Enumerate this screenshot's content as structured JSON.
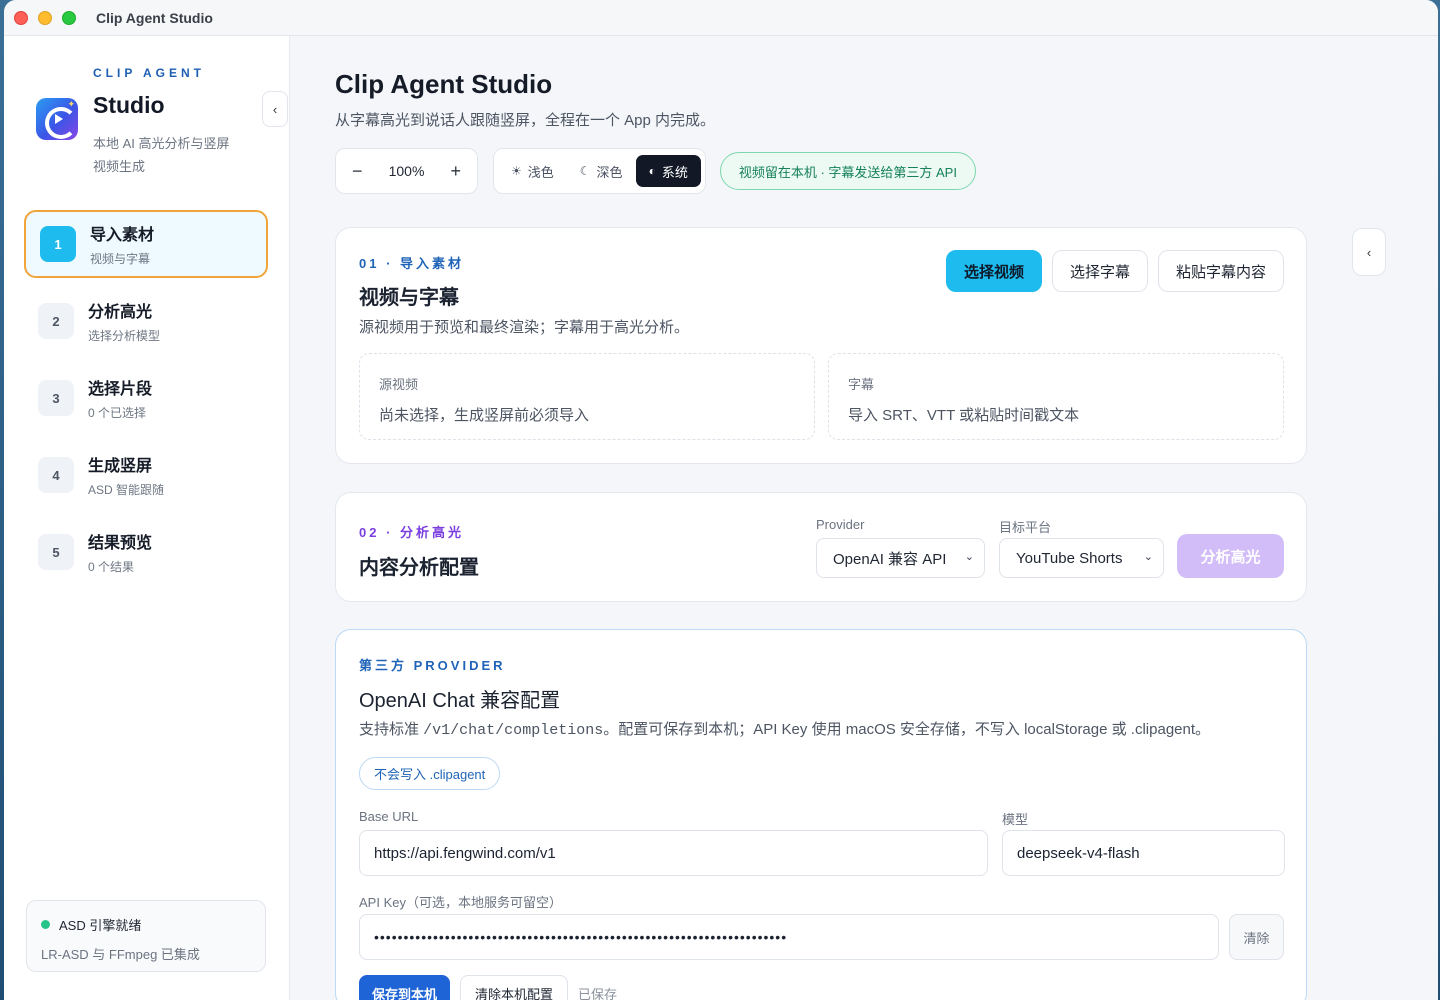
{
  "window": {
    "title": "Clip Agent Studio"
  },
  "sidebar": {
    "eyebrow": "CLIP AGENT",
    "name": "Studio",
    "description": "本地 AI 高光分析与竖屏视频生成",
    "collapse_glyph": "‹",
    "steps": [
      {
        "num": "1",
        "title": "导入素材",
        "subtitle": "视频与字幕"
      },
      {
        "num": "2",
        "title": "分析高光",
        "subtitle": "选择分析模型"
      },
      {
        "num": "3",
        "title": "选择片段",
        "subtitle": "0 个已选择"
      },
      {
        "num": "4",
        "title": "生成竖屏",
        "subtitle": "ASD 智能跟随"
      },
      {
        "num": "5",
        "title": "结果预览",
        "subtitle": "0 个结果"
      }
    ],
    "engine": {
      "status": "ASD 引擎就绪",
      "detail": "LR-ASD 与 FFmpeg 已集成"
    }
  },
  "header": {
    "title": "Clip Agent Studio",
    "subtitle": "从字幕高光到说话人跟随竖屏，全程在一个 App 内完成。"
  },
  "toolbar": {
    "zoom_minus": "−",
    "zoom_value": "100%",
    "zoom_plus": "+",
    "theme_light": "浅色",
    "theme_dark": "深色",
    "theme_system": "系统",
    "theme_selected": "系统",
    "privacy": "视频留在本机 · 字幕发送给第三方 API"
  },
  "import_card": {
    "eyebrow": "01 · 导入素材",
    "title": "视频与字幕",
    "description": "源视频用于预览和最终渲染；字幕用于高光分析。",
    "btn_select_video": "选择视频",
    "btn_select_subtitle": "选择字幕",
    "btn_paste_subtitle": "粘贴字幕内容",
    "video_label": "源视频",
    "video_value": "尚未选择，生成竖屏前必须导入",
    "subtitle_label": "字幕",
    "subtitle_value": "导入 SRT、VTT 或粘贴时间戳文本"
  },
  "analyze_card": {
    "eyebrow": "02 · 分析高光",
    "title": "内容分析配置",
    "provider_label": "Provider",
    "provider_value": "OpenAI 兼容 API",
    "platform_label": "目标平台",
    "platform_value": "YouTube Shorts",
    "btn_analyze": "分析高光"
  },
  "provider_card": {
    "eyebrow": "第三方 PROVIDER",
    "title": "OpenAI Chat 兼容配置",
    "desc_prefix": "支持标准 ",
    "desc_code": "/v1/chat/completions",
    "desc_suffix": "。配置可保存到本机；API Key 使用 macOS 安全存储，不写入 localStorage 或 .clipagent。",
    "note": "不会写入 .clipagent",
    "base_url_label": "Base URL",
    "base_url_value": "https://api.fengwind.com/v1",
    "model_label": "模型",
    "model_value": "deepseek-v4-flash",
    "api_key_label": "API Key（可选，本地服务可留空）",
    "api_key_value": "••••••••••••••••••••••••••••••••••••••••••••••••••••••••••••••••••••••",
    "btn_clear": "清除",
    "btn_save": "保存到本机",
    "btn_clear_local": "清除本机配置",
    "saved_status": "已保存"
  },
  "colors": {
    "accent": "#1ebbef",
    "active_border": "#f0a53a",
    "analyze_disabled": "#d3bdf8",
    "success": "#27c48a"
  }
}
